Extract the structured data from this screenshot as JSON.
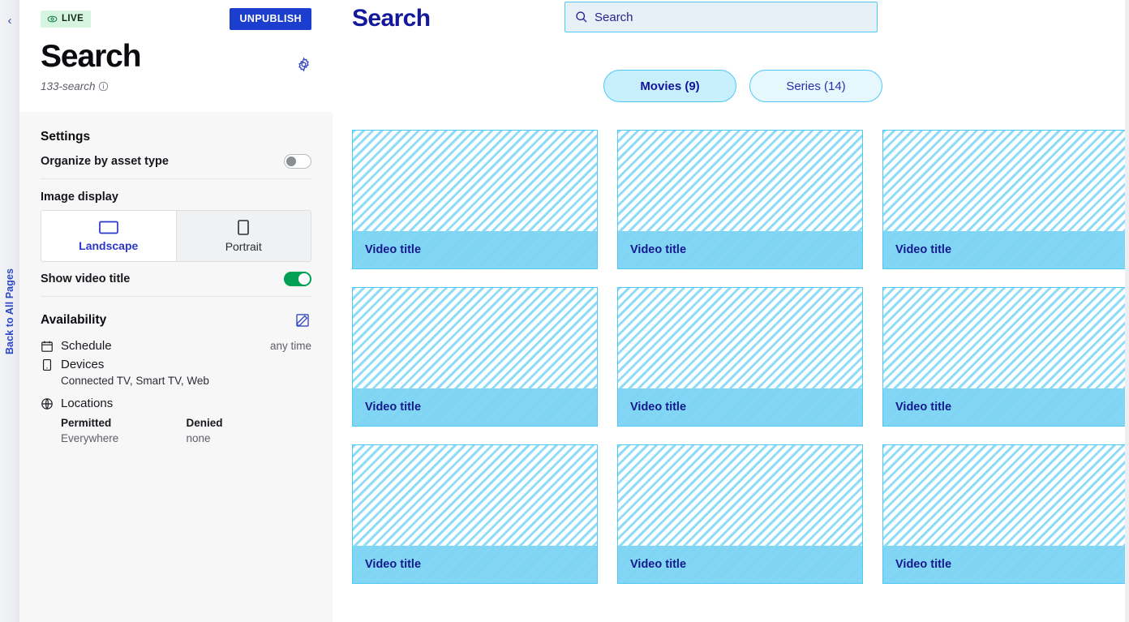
{
  "rail": {
    "collapse_icon": "chevron-left-icon",
    "back_label": "Back to All Pages"
  },
  "panel": {
    "status_badge": {
      "label": "LIVE",
      "icon": "eye-icon",
      "bg": "#d6f5e0",
      "fg": "#13261c"
    },
    "unpublish_label": "UNPUBLISH",
    "unpublish_color": "#1b3ecf",
    "title": "Search",
    "slug": "133-search",
    "slug_info_icon": "info-icon",
    "settings_icon": "gear-icon",
    "settings": {
      "heading": "Settings",
      "organize_label": "Organize by asset type",
      "organize_state": "off",
      "image_display_label": "Image display",
      "image_display_options": [
        {
          "label": "Landscape",
          "icon": "landscape-rect-icon",
          "selected": true
        },
        {
          "label": "Portrait",
          "icon": "portrait-rect-icon",
          "selected": false
        }
      ],
      "show_video_title_label": "Show video title",
      "show_video_title_state": "on"
    },
    "availability": {
      "heading": "Availability",
      "edit_icon": "edit-pencil-icon",
      "schedule_label": "Schedule",
      "schedule_icon": "calendar-icon",
      "schedule_value": "any time",
      "devices_label": "Devices",
      "devices_icon": "device-icon",
      "devices_value": "Connected TV, Smart TV, Web",
      "locations_label": "Locations",
      "locations_icon": "globe-icon",
      "permitted_header": "Permitted",
      "permitted_value": "Everywhere",
      "denied_header": "Denied",
      "denied_value": "none"
    }
  },
  "main": {
    "title": "Search",
    "search": {
      "placeholder": "Search",
      "value": "",
      "icon": "search-icon"
    },
    "tabs": [
      {
        "label": "Movies (9)",
        "active": true
      },
      {
        "label": "Series (14)",
        "active": false
      }
    ],
    "cards": [
      {
        "title": "Video title"
      },
      {
        "title": "Video title"
      },
      {
        "title": "Video title"
      },
      {
        "title": "Video title"
      },
      {
        "title": "Video title"
      },
      {
        "title": "Video title"
      },
      {
        "title": "Video title"
      },
      {
        "title": "Video title"
      },
      {
        "title": "Video title"
      }
    ]
  },
  "colors": {
    "accent_blue": "#1b3ecf",
    "cyan_border": "#4ec8f5",
    "card_fill": "#8fdcf8",
    "title_navy": "#141a8c",
    "toggle_on": "#00a152"
  }
}
